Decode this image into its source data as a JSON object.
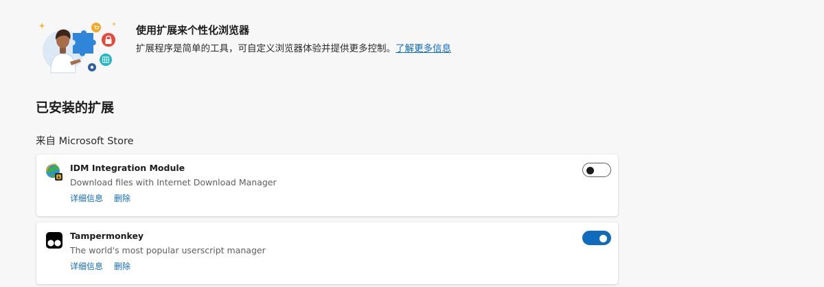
{
  "hero": {
    "title": "使用扩展来个性化浏览器",
    "description": "扩展程序是简单的工具，可自定义浏览器体验并提供更多控制。",
    "learn_more": "了解更多信息"
  },
  "installed": {
    "heading": "已安装的扩展",
    "source_label": "来自 Microsoft Store"
  },
  "extensions": [
    {
      "name": "IDM Integration Module",
      "description": "Download files with Internet Download Manager",
      "details_label": "详细信息",
      "remove_label": "删除",
      "enabled": false,
      "icon": "idm-globe-icon"
    },
    {
      "name": "Tampermonkey",
      "description": "The world's most popular userscript manager",
      "details_label": "详细信息",
      "remove_label": "删除",
      "enabled": true,
      "icon": "tampermonkey-icon"
    }
  ],
  "colors": {
    "accent": "#0f6cbd",
    "background": "#f7f7f7",
    "card": "#ffffff"
  }
}
